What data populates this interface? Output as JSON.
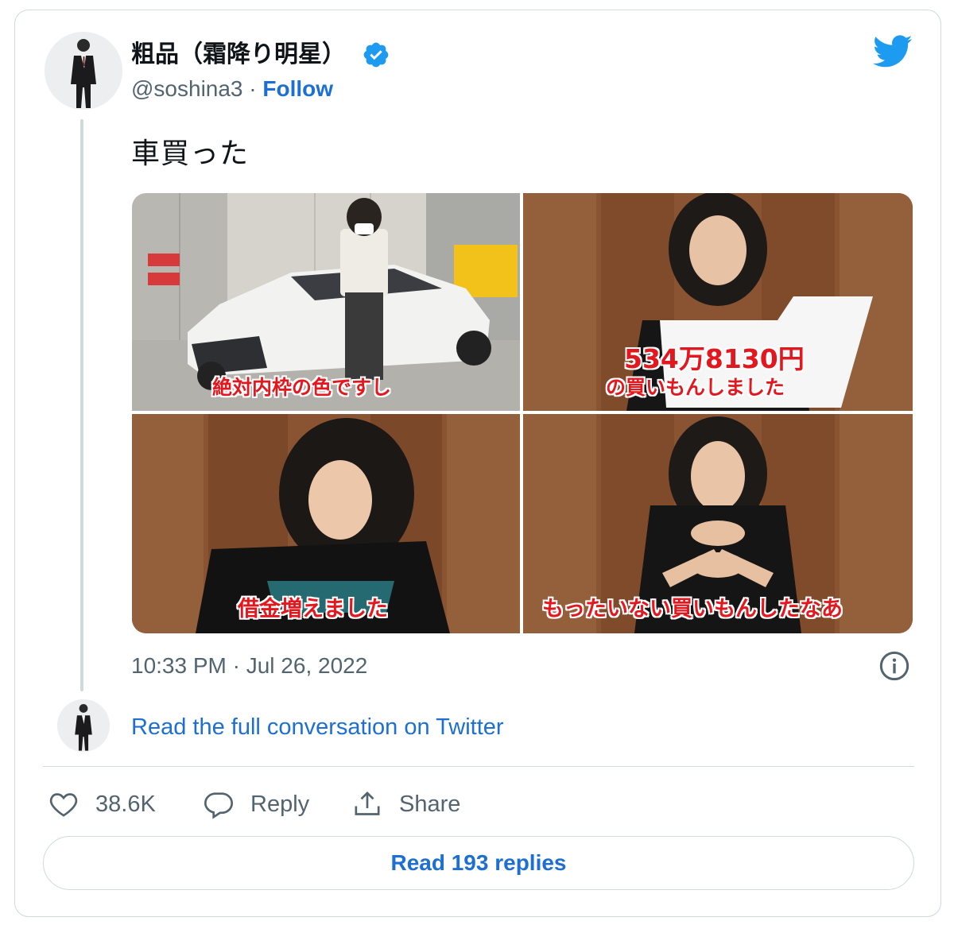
{
  "author": {
    "name": "粗品（霜降り明星）",
    "handle": "@soshina3",
    "separator": " · ",
    "follow_label": "Follow",
    "verified": true,
    "avatar_icon": "person-in-suit-avatar"
  },
  "brand": {
    "logo_icon": "twitter-bird-icon",
    "color": "#1d9bf0"
  },
  "tweet": {
    "text": "車買った",
    "timestamp": "10:33 PM · Jul 26, 2022"
  },
  "media": [
    {
      "caption_lines": [
        "絶対内枠の色ですし"
      ]
    },
    {
      "caption_lines": [
        "534万8130円",
        "の買いもんしました"
      ]
    },
    {
      "caption_lines": [
        "借金増えました"
      ]
    },
    {
      "caption_lines": [
        "もったいない買いもんしたなあ"
      ]
    }
  ],
  "thread": {
    "read_full_label": "Read the full conversation on Twitter"
  },
  "actions": {
    "like_count": "38.6K",
    "reply_label": "Reply",
    "share_label": "Share"
  },
  "replies_button_label": "Read 193 replies",
  "colors": {
    "link": "#1d6fd1",
    "muted_text": "#536471",
    "border": "#cfd9de",
    "caption_red": "#e3171e"
  }
}
